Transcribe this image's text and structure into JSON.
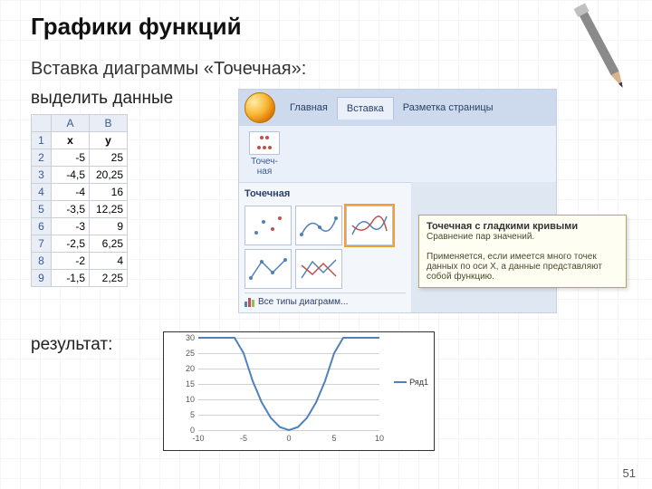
{
  "title": "Графики функций",
  "subtitle": "Вставка диаграммы «Точечная»:",
  "captions": {
    "select_data": "выделить данные",
    "result": "результат:"
  },
  "spreadsheet": {
    "cols": [
      "A",
      "B"
    ],
    "header_row": [
      "x",
      "y"
    ],
    "rows": [
      [
        "-5",
        "25"
      ],
      [
        "-4,5",
        "20,25"
      ],
      [
        "-4",
        "16"
      ],
      [
        "-3,5",
        "12,25"
      ],
      [
        "-3",
        "9"
      ],
      [
        "-2,5",
        "6,25"
      ],
      [
        "-2",
        "4"
      ],
      [
        "-1,5",
        "2,25"
      ]
    ],
    "row_nums": [
      "1",
      "2",
      "3",
      "4",
      "5",
      "6",
      "7",
      "8",
      "9"
    ]
  },
  "ribbon": {
    "tabs": [
      "Главная",
      "Вставка",
      "Разметка страницы"
    ],
    "active_tab": "Вставка",
    "scatter_btn": "Точеч-ная",
    "gallery_title": "Точечная",
    "gallery_footer": "Все типы диаграмм...",
    "tooltip": {
      "title": "Точечная с гладкими кривыми",
      "line1": "Сравнение пар значений.",
      "line2": "Применяется, если имеется много точек данных по оси X, а данные представляют собой функцию."
    }
  },
  "chart_data": {
    "type": "line",
    "series": [
      {
        "name": "Ряд1",
        "x": [
          -10,
          -8,
          -6,
          -5,
          -4,
          -3,
          -2,
          -1,
          0,
          1,
          2,
          3,
          4,
          5,
          6,
          8,
          10
        ],
        "y": [
          30,
          30,
          30,
          25,
          16,
          9,
          4,
          1,
          0,
          1,
          4,
          9,
          16,
          25,
          30,
          30,
          30
        ]
      }
    ],
    "xlabel": "",
    "ylabel": "",
    "x_ticks": [
      -10,
      -5,
      0,
      5,
      10
    ],
    "y_ticks": [
      0,
      5,
      10,
      15,
      20,
      25,
      30
    ],
    "xlim": [
      -10,
      10
    ],
    "ylim": [
      0,
      30
    ],
    "legend": "Ряд1",
    "color": "#4f81bd"
  },
  "page_number": "51"
}
